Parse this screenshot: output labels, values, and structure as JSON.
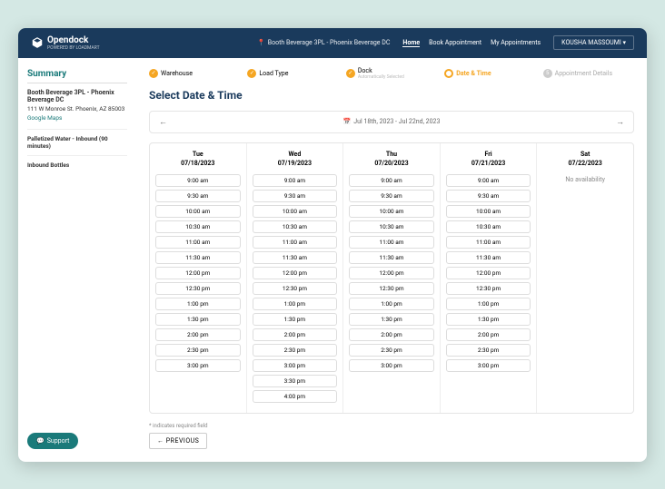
{
  "brand": "Opendock",
  "brand_sub": "POWERED BY LOADMART",
  "location": "Booth Beverage 3PL - Phoenix Beverage DC",
  "nav": {
    "home": "Home",
    "book": "Book Appointment",
    "my": "My Appointments"
  },
  "user": "KOUSHA MASSOUMI",
  "sidebar": {
    "title": "Summary",
    "wh": "Booth Beverage 3PL - Phoenix Beverage DC",
    "addr": "111 W Monroe St. Phoenix, AZ 85003",
    "maps": "Google Maps",
    "load": "Palletized Water - Inbound (90 minutes)",
    "dock": "Inbound Bottles"
  },
  "steps": {
    "s1": "Warehouse",
    "s2": "Load Type",
    "s3": "Dock",
    "s3_sub": "Automatically Selected",
    "s4": "Date & Time",
    "s5": "Appointment Details"
  },
  "heading": "Select Date & Time",
  "range": "Jul 18th, 2023 - Jul 22nd, 2023",
  "days": [
    {
      "d": "Tue",
      "dt": "07/18/2023",
      "slots": [
        "9:00 am",
        "9:30 am",
        "10:00 am",
        "10:30 am",
        "11:00 am",
        "11:30 am",
        "12:00 pm",
        "12:30 pm",
        "1:00 pm",
        "1:30 pm",
        "2:00 pm",
        "2:30 pm",
        "3:00 pm"
      ]
    },
    {
      "d": "Wed",
      "dt": "07/19/2023",
      "slots": [
        "9:00 am",
        "9:30 am",
        "10:00 am",
        "10:30 am",
        "11:00 am",
        "11:30 am",
        "12:00 pm",
        "12:30 pm",
        "1:00 pm",
        "1:30 pm",
        "2:00 pm",
        "2:30 pm",
        "3:00 pm",
        "3:30 pm",
        "4:00 pm"
      ]
    },
    {
      "d": "Thu",
      "dt": "07/20/2023",
      "slots": [
        "9:00 am",
        "9:30 am",
        "10:00 am",
        "10:30 am",
        "11:00 am",
        "11:30 am",
        "12:00 pm",
        "12:30 pm",
        "1:00 pm",
        "1:30 pm",
        "2:00 pm",
        "2:30 pm",
        "3:00 pm"
      ]
    },
    {
      "d": "Fri",
      "dt": "07/21/2023",
      "slots": [
        "9:00 am",
        "9:30 am",
        "10:00 am",
        "10:30 am",
        "11:00 am",
        "11:30 am",
        "12:00 pm",
        "12:30 pm",
        "1:00 pm",
        "1:30 pm",
        "2:00 pm",
        "2:30 pm",
        "3:00 pm"
      ]
    },
    {
      "d": "Sat",
      "dt": "07/22/2023",
      "slots": [],
      "none": "No availability"
    }
  ],
  "req": "* indicates required field",
  "prev": "PREVIOUS",
  "support": "Support"
}
